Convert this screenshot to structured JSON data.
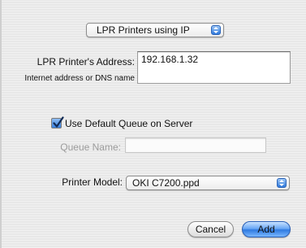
{
  "connection_popup": {
    "value": "LPR Printers using IP"
  },
  "address": {
    "label": "LPR Printer's Address:",
    "hint": "Internet address or DNS name",
    "value": "192.168.1.32"
  },
  "default_queue": {
    "label": "Use Default Queue on Server",
    "checked": true
  },
  "queue_name": {
    "label": "Queue Name:",
    "value": ""
  },
  "printer_model": {
    "label": "Printer Model:",
    "value": "OKI C7200.ppd"
  },
  "buttons": {
    "cancel": "Cancel",
    "add": "Add"
  },
  "colors": {
    "accent": "#3a82e0",
    "default_button": "#2f7ae0"
  },
  "icons": {
    "popup_arrows": "up-down-arrows-icon",
    "checkmark": "checkmark-icon"
  }
}
